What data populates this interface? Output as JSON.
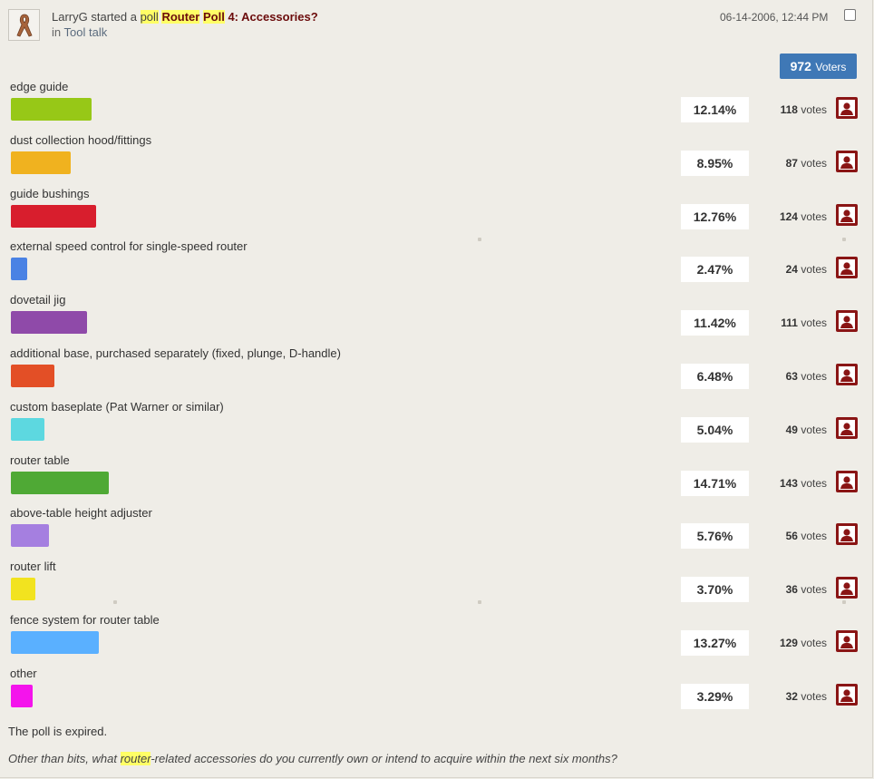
{
  "header": {
    "user": "LarryG",
    "started_a": "started a",
    "poll_word": "poll",
    "title_parts": [
      "Router",
      "Poll",
      "4: Accessories?"
    ],
    "in_label": "in",
    "forum": "Tool talk",
    "date": "06-14-2006, 12:44 PM"
  },
  "voters": {
    "count": "972",
    "label": "Voters"
  },
  "options": [
    {
      "label": "edge guide",
      "percent": "12.14%",
      "votes": "118",
      "votes_label": "votes",
      "fraction": 0.1214,
      "color": "#97c817"
    },
    {
      "label": "dust collection hood/fittings",
      "percent": "8.95%",
      "votes": "87",
      "votes_label": "votes",
      "fraction": 0.0895,
      "color": "#f0b21f"
    },
    {
      "label": "guide bushings",
      "percent": "12.76%",
      "votes": "124",
      "votes_label": "votes",
      "fraction": 0.1276,
      "color": "#d81e2d"
    },
    {
      "label": "external speed control for single-speed router",
      "percent": "2.47%",
      "votes": "24",
      "votes_label": "votes",
      "fraction": 0.0247,
      "color": "#4a82e4"
    },
    {
      "label": "dovetail jig",
      "percent": "11.42%",
      "votes": "111",
      "votes_label": "votes",
      "fraction": 0.1142,
      "color": "#8f4aa9"
    },
    {
      "label": "additional base, purchased separately (fixed, plunge, D-handle)",
      "percent": "6.48%",
      "votes": "63",
      "votes_label": "votes",
      "fraction": 0.0648,
      "color": "#e34f26"
    },
    {
      "label": "custom baseplate (Pat Warner or similar)",
      "percent": "5.04%",
      "votes": "49",
      "votes_label": "votes",
      "fraction": 0.0504,
      "color": "#5dd8e0"
    },
    {
      "label": "router table",
      "percent": "14.71%",
      "votes": "143",
      "votes_label": "votes",
      "fraction": 0.1471,
      "color": "#4fa935"
    },
    {
      "label": "above-table height adjuster",
      "percent": "5.76%",
      "votes": "56",
      "votes_label": "votes",
      "fraction": 0.0576,
      "color": "#a57fe0"
    },
    {
      "label": "router lift",
      "percent": "3.70%",
      "votes": "36",
      "votes_label": "votes",
      "fraction": 0.037,
      "color": "#f2e31f"
    },
    {
      "label": "fence system for router table",
      "percent": "13.27%",
      "votes": "129",
      "votes_label": "votes",
      "fraction": 0.1327,
      "color": "#5ab0ff"
    },
    {
      "label": "other",
      "percent": "3.29%",
      "votes": "32",
      "votes_label": "votes",
      "fraction": 0.0329,
      "color": "#f414ec"
    }
  ],
  "footer": {
    "expired": "The poll is expired.",
    "question_parts": [
      "Other than bits, what ",
      "router",
      "-related accessories do you currently own or intend to acquire within the next six months?"
    ]
  },
  "icons": {
    "avatar": "ribbon-icon",
    "voter_list": "user-icon",
    "select": "checkbox"
  },
  "colors": {
    "voters_badge": "#3f78b6",
    "title": "#6b0b0b",
    "highlight": "#ffff66",
    "user_icon_bg": "#8a1515"
  }
}
